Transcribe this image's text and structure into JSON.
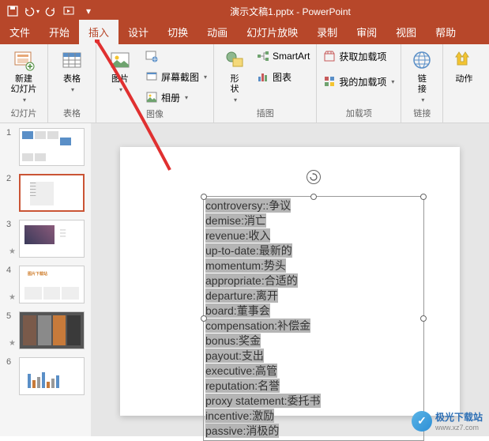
{
  "title": "演示文稿1.pptx - PowerPoint",
  "qat": {
    "save": "保存",
    "undo": "撤销",
    "redo": "重做",
    "start": "从头开始"
  },
  "tabs": {
    "file": "文件",
    "home": "开始",
    "insert": "插入",
    "design": "设计",
    "transitions": "切换",
    "animations": "动画",
    "slideshow": "幻灯片放映",
    "record": "录制",
    "review": "审阅",
    "view": "视图",
    "help": "帮助"
  },
  "ribbon": {
    "newSlide": "新建\n幻灯片",
    "slidesGroup": "幻灯片",
    "table": "表格",
    "tablesGroup": "表格",
    "pictures": "图片",
    "screenshot": "屏幕截图",
    "album": "相册",
    "imagesGroup": "图像",
    "shapes": "形\n状",
    "smartart": "SmartArt",
    "chart": "图表",
    "illustrationsGroup": "插图",
    "getAddins": "获取加载项",
    "myAddins": "我的加载项",
    "addinsGroup": "加载项",
    "link": "链\n接",
    "linksGroup": "链接",
    "action": "动作"
  },
  "thumbs": [
    {
      "num": "1",
      "star": false
    },
    {
      "num": "2",
      "star": false,
      "selected": true
    },
    {
      "num": "3",
      "star": true
    },
    {
      "num": "4",
      "star": true
    },
    {
      "num": "5",
      "star": true
    },
    {
      "num": "6",
      "star": false
    }
  ],
  "textLines": [
    "controversy::争议",
    "demise:消亡",
    "revenue:收入",
    "up-to-date:最新的",
    "momentum:势头",
    "appropriate:合适的",
    "departure:离开",
    "board:董事会",
    "compensation:补偿金",
    "bonus:奖金",
    "payout:支出",
    "executive:高管",
    "reputation:名誉",
    "proxy statement:委托书",
    "incentive:激励",
    "passive:消极的"
  ],
  "watermark": {
    "name": "极光下载站",
    "url": "www.xz7.com"
  }
}
